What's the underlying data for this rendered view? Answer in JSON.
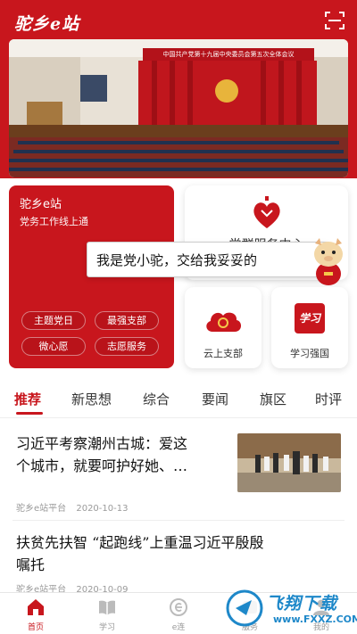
{
  "header": {
    "title": "驼乡e站"
  },
  "banner": {
    "caption": "中国共产党第十九届中央委员会第五次全体会议"
  },
  "card_left": {
    "title": "驼乡e站",
    "subtitle": "党务工作线上通",
    "pills": [
      "主题党日",
      "最强支部",
      "微心愿",
      "志愿服务"
    ]
  },
  "cards": {
    "service": "党群服务中心",
    "cloud": "云上支部",
    "study": "学习强国",
    "study_badge": "学习"
  },
  "bubble": {
    "text": "我是党小驼，交给我妥妥的"
  },
  "tabs": [
    "推荐",
    "新思想",
    "综合",
    "要闻",
    "旗区",
    "时评"
  ],
  "news": [
    {
      "title_line1": "习近平考察潮州古城：爱这",
      "title_line2": "个城市，就要呵护好她、…",
      "source": "驼乡e站平台",
      "date": "2020-10-13"
    },
    {
      "title_line1": "扶贫先扶智 “起跑线”上重温习近平殷殷",
      "title_line2": "嘱托",
      "source": "驼乡e站平台",
      "date": "2020-10-09"
    }
  ],
  "bottom_nav": [
    "首页",
    "学习",
    "e连",
    "服务",
    "我的"
  ],
  "watermark": {
    "cn": "飞翔下载",
    "url": "www.FXXZ.COM"
  },
  "colors": {
    "primary": "#c8161d",
    "muted": "#999999"
  }
}
